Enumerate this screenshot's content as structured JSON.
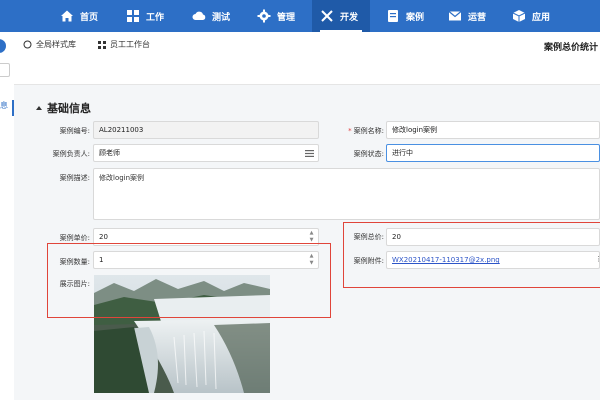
{
  "nav": {
    "items": [
      {
        "label": "首页",
        "icon": "home-icon"
      },
      {
        "label": "工作",
        "icon": "grid-icon"
      },
      {
        "label": "测试",
        "icon": "cloud-icon"
      },
      {
        "label": "管理",
        "icon": "gear-icon"
      },
      {
        "label": "开发",
        "icon": "tools-icon",
        "active": true
      },
      {
        "label": "案例",
        "icon": "document-icon"
      },
      {
        "label": "运营",
        "icon": "mail-icon"
      },
      {
        "label": "应用",
        "icon": "cube-icon"
      }
    ]
  },
  "subnav": {
    "style_lib": "全局样式库",
    "workbench": "员工工作台",
    "page_title": "案例总价统计"
  },
  "sidebar": {
    "stub_label": "息"
  },
  "section": {
    "title": "基础信息"
  },
  "form": {
    "case_no_label": "案例编号:",
    "case_no_value": "AL20211003",
    "case_name_label": "案例名称:",
    "case_name_value": "修改login案例",
    "owner_label": "案例负责人:",
    "owner_value": "顾老师",
    "status_label": "案例状态:",
    "status_value": "进行中",
    "desc_label": "案例描述:",
    "desc_value": "修改login案例",
    "unit_price_label": "案例单价:",
    "unit_price_value": "20",
    "total_label": "案例总价:",
    "total_value": "20",
    "qty_label": "案例数量:",
    "qty_value": "1",
    "attach_label": "案例附件:",
    "attach_value": "WX20210417-110317@2x.png",
    "image_label": "展示图片:"
  },
  "colors": {
    "primary": "#2d6fc6",
    "highlight_box": "#e0453a",
    "required": "#e03c3c"
  }
}
